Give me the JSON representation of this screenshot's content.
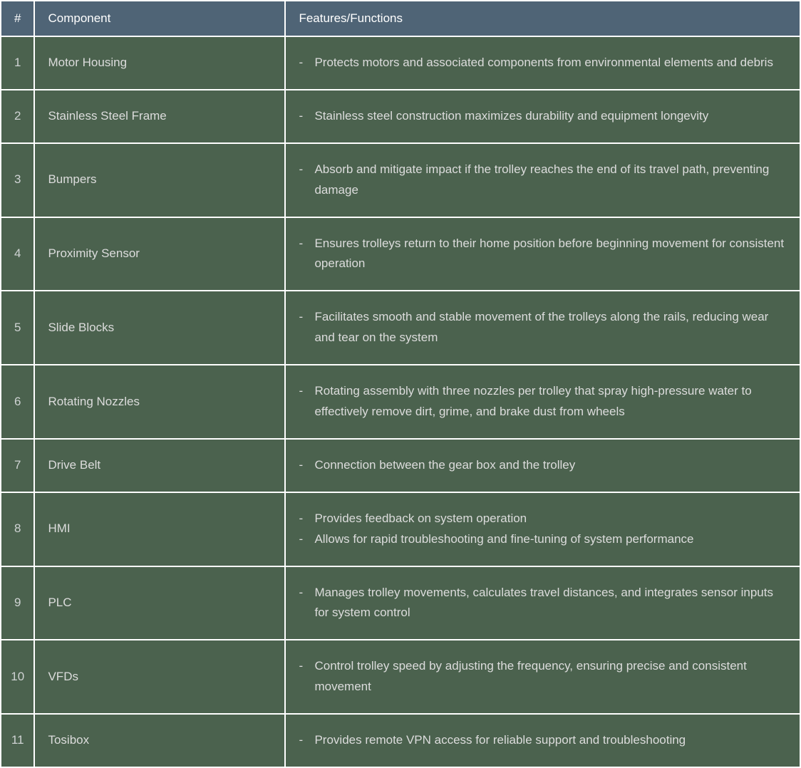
{
  "headers": {
    "num": "#",
    "component": "Component",
    "features": "Features/Functions"
  },
  "rows": [
    {
      "num": "1",
      "component": "Motor Housing",
      "features": [
        "Protects motors and associated components from environmental elements and debris"
      ]
    },
    {
      "num": "2",
      "component": "Stainless Steel Frame",
      "features": [
        "Stainless steel construction maximizes durability and equipment longevity"
      ]
    },
    {
      "num": "3",
      "component": "Bumpers",
      "features": [
        "Absorb and mitigate impact if the trolley reaches the end of its travel path, preventing damage"
      ]
    },
    {
      "num": "4",
      "component": "Proximity Sensor",
      "features": [
        "Ensures trolleys return to their home position before beginning movement for consistent operation"
      ]
    },
    {
      "num": "5",
      "component": "Slide Blocks",
      "features": [
        "Facilitates smooth and stable movement of the trolleys along the rails, reducing wear and tear on the system"
      ]
    },
    {
      "num": "6",
      "component": "Rotating Nozzles",
      "features": [
        "Rotating assembly with three nozzles per trolley that spray high-pressure water to effectively remove dirt, grime, and brake dust from wheels"
      ]
    },
    {
      "num": "7",
      "component": "Drive Belt",
      "features": [
        "Connection between the gear box and the trolley"
      ]
    },
    {
      "num": "8",
      "component": "HMI",
      "features": [
        "Provides feedback on system operation",
        "Allows for rapid troubleshooting and fine-tuning of system performance"
      ]
    },
    {
      "num": "9",
      "component": "PLC",
      "features": [
        "Manages trolley movements, calculates travel distances, and integrates sensor inputs for system control"
      ]
    },
    {
      "num": "10",
      "component": "VFDs",
      "features": [
        "Control trolley speed by adjusting the frequency, ensuring precise and consistent movement"
      ]
    },
    {
      "num": "11",
      "component": "Tosibox",
      "features": [
        "Provides remote VPN access for reliable support and troubleshooting"
      ]
    }
  ]
}
